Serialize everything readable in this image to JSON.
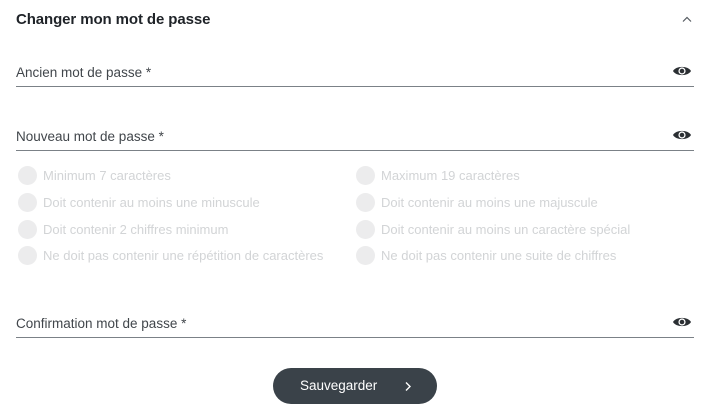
{
  "header": {
    "title": "Changer mon mot de passe",
    "collapse_icon": "chevron-up-icon"
  },
  "fields": {
    "old_password": {
      "label": "Ancien mot de passe *",
      "value": "",
      "icon": "eye-icon"
    },
    "new_password": {
      "label": "Nouveau mot de passe *",
      "value": "",
      "icon": "eye-icon"
    },
    "confirm_password": {
      "label": "Confirmation mot de passe *",
      "value": "",
      "icon": "eye-icon"
    }
  },
  "rules": {
    "left": [
      "Minimum 7 caractères",
      "Doit contenir au moins une minuscule",
      "Doit contenir 2 chiffres minimum",
      "Ne doit pas contenir une répétition de caractères"
    ],
    "right": [
      "Maximum 19 caractères",
      "Doit contenir au moins une majuscule",
      "Doit contenir au moins un caractère spécial",
      "Ne doit pas contenir une suite de chiffres"
    ]
  },
  "save_button": {
    "label": "Sauvegarder",
    "icon": "chevron-right-icon"
  },
  "colors": {
    "button_bg": "#3a4249",
    "rule_text_inactive": "#d2d4d6",
    "rule_dot_inactive": "#ececed"
  }
}
